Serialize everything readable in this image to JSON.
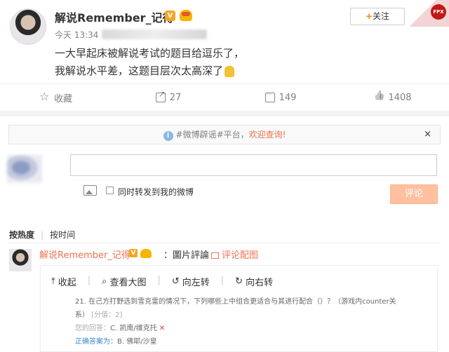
{
  "post": {
    "username": "解说Remember_记得",
    "verified_badge": "V",
    "follow_plus": "+",
    "follow_label": "关注",
    "logo_text": "FPX",
    "time": "今天 13:34",
    "text_line1": "一大早起床被解说考试的题目给逗乐了，",
    "text_line2": "我解说水平差，这题目层次太高深了"
  },
  "actions": {
    "favorite_label": "收藏",
    "share_count": "27",
    "comment_count": "149",
    "like_count": "1408"
  },
  "notice": {
    "info_glyph": "i",
    "text": "#微博辟谣#平台，",
    "link": "欢迎查询!",
    "close": "×"
  },
  "composer": {
    "repost_label": "同时转发到我的微博",
    "submit_label": "评论"
  },
  "sort": {
    "hot": "按热度",
    "time": "按时间",
    "separator": "|"
  },
  "reply": {
    "name": "解说Remember_记得",
    "verified_badge": "V",
    "text": "：圖片評論",
    "link": "评论配图"
  },
  "image_toolbar": {
    "collapse": "收起",
    "view_large": "查看大图",
    "rotate_left": "向左转",
    "rotate_right": "向右转",
    "separator": "|"
  },
  "exam": {
    "question": "21. 在己方打野选到雪克雷的情况下，下列哪些上中组合更适合与其进行配合（）？（游戏内counter关",
    "question_cont": "系）",
    "score": "[分值：2]",
    "your_answer_label": "您的回答：",
    "your_answer": "C. 凯南/维克托",
    "wrong_mark": "✕",
    "correct_label": "正确答案为：",
    "correct_answer": "B. 佛耶/沙皇"
  },
  "colors": {
    "accent": "#eb7350",
    "orange": "#ff8200",
    "submit_bg": "#ffc09f",
    "link_blue": "#3b88d1"
  },
  "icons": [
    "star-icon",
    "share-icon",
    "comment-icon",
    "like-icon",
    "image-icon",
    "info-icon",
    "close-icon"
  ]
}
